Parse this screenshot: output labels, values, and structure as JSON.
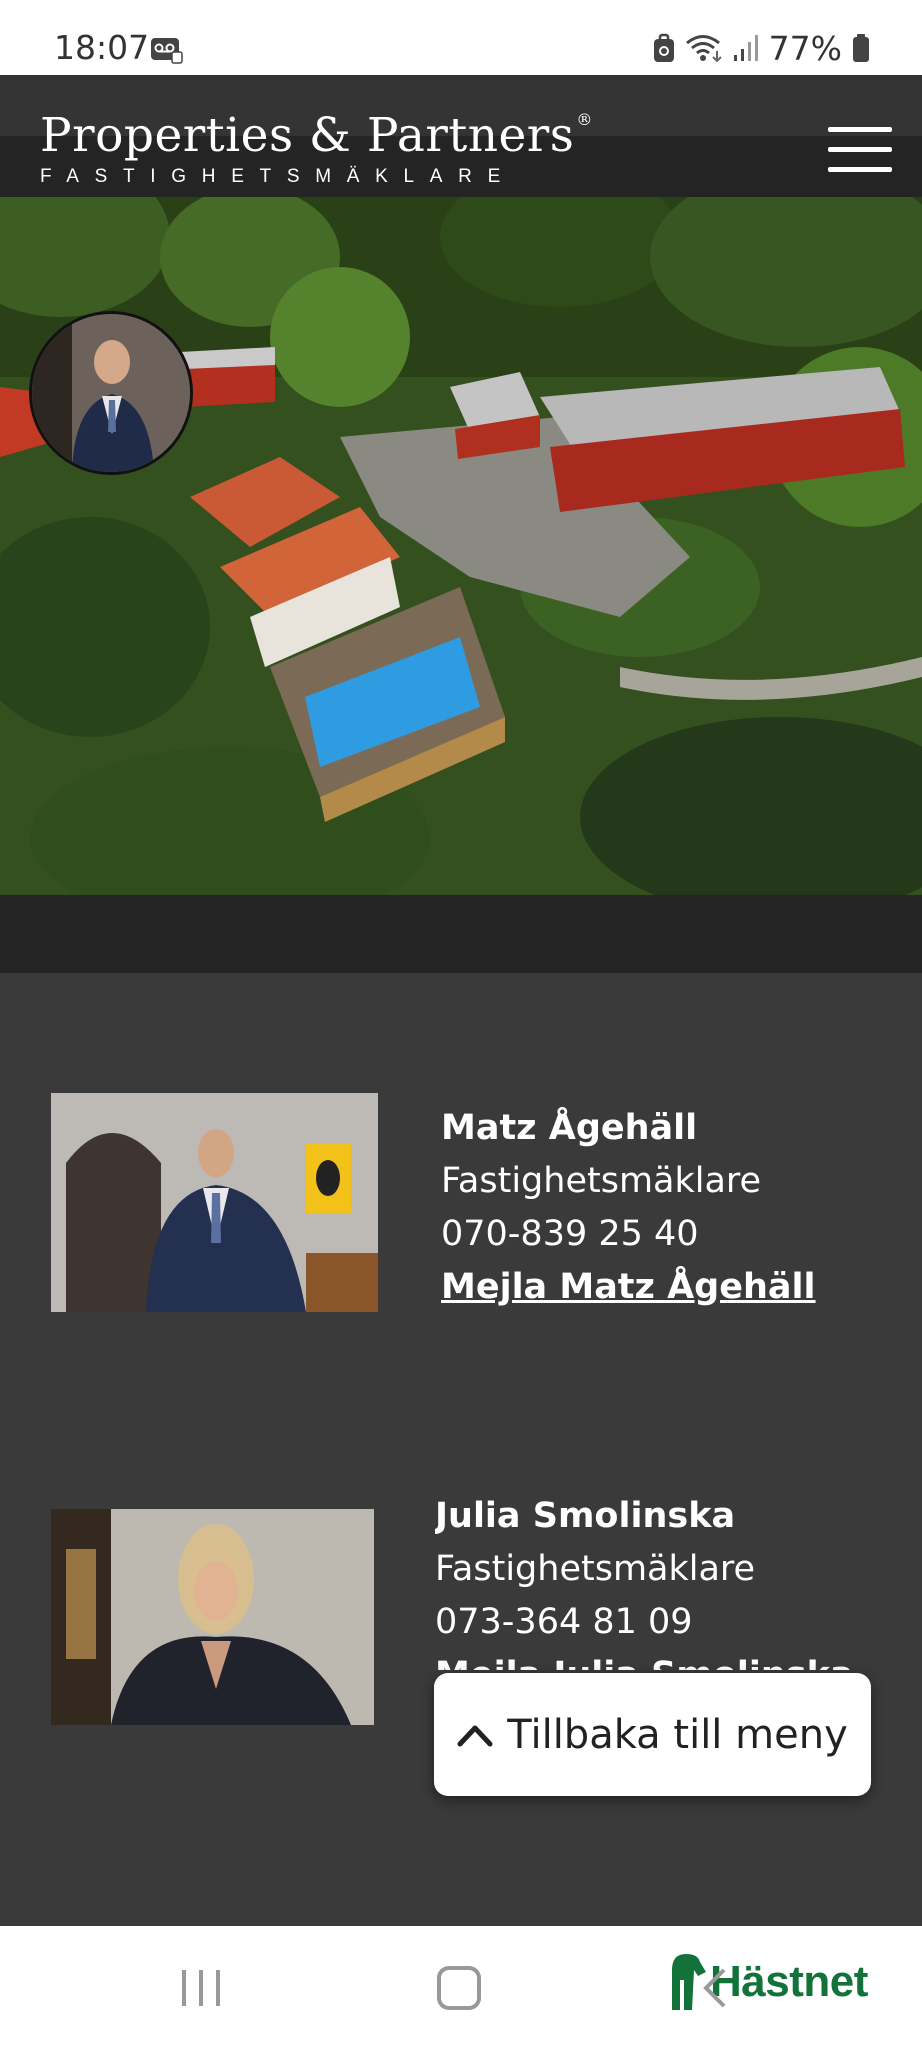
{
  "status_bar": {
    "time": "18:07",
    "battery_percent": "77%",
    "icons": [
      "voicemail-icon",
      "lock-icon",
      "wifi-icon",
      "signal-icon",
      "battery-icon"
    ]
  },
  "header": {
    "logo_title": "Properties & Partners",
    "logo_registered": "®",
    "logo_subtitle": "FASTIGHETSMÄKLARE",
    "menu_icon": "hamburger-menu-icon"
  },
  "agents": [
    {
      "name": "Matz Ågehäll",
      "title": "Fastighetsmäklare",
      "phone": "070-839 25 40",
      "email_link": "Mejla Matz Ågehäll"
    },
    {
      "name": "Julia Smolinska",
      "title": "Fastighetsmäklare",
      "phone": "073-364 81 09",
      "email_link": "Mejla Julia Smolinska"
    }
  ],
  "back_to_menu": {
    "label": "Tillbaka till meny",
    "icon": "chevron-up-icon"
  },
  "nav_bar": {
    "brand": "Hästnet",
    "colors": {
      "brand": "#12723a"
    }
  },
  "colors": {
    "page_background": "#3a3a3a",
    "header_background": "#242424",
    "text": "#ffffff"
  }
}
